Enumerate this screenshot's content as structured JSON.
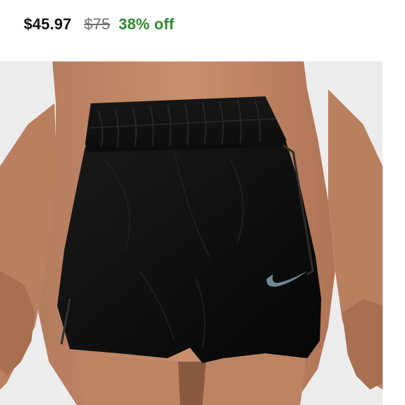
{
  "listing": {
    "price_current": "$45.97",
    "price_original": "$75",
    "discount": "38% off",
    "discount_color": "#2f8a2f"
  },
  "product_image": {
    "subject": "black running shorts with elastic waistband and swoosh logo",
    "logo_color": "#6f8a93"
  }
}
